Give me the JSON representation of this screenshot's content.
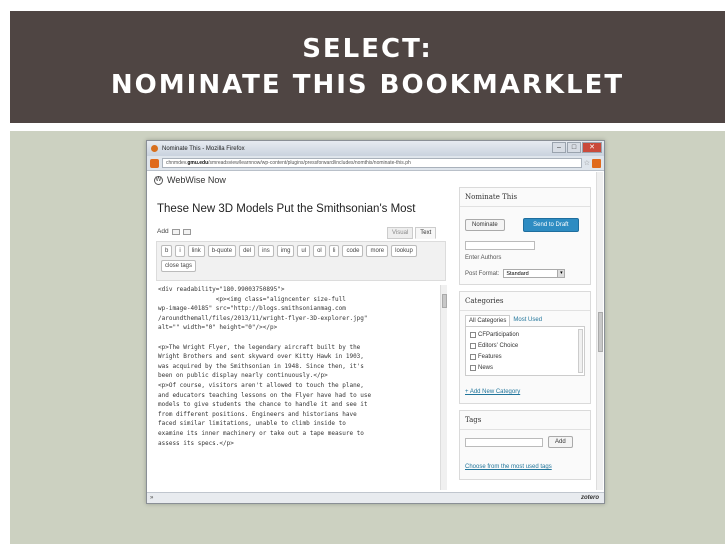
{
  "slide": {
    "title_line1": "SELECT:",
    "title_line2": "NOMINATE THIS BOOKMARKLET"
  },
  "browser": {
    "window_title": "Nominate This - Mozilla Firefox",
    "url_prefix": "chnmdev.",
    "url_domain": "gmu.edu",
    "url_rest": "/smreadsview/learnnow/wp-content/plugins/pressforward/includes/nomthis/nominate-this.ph",
    "min": "–",
    "max": "□",
    "close": "✕"
  },
  "editor": {
    "site_name": "WebWise Now",
    "post_title": "These New 3D Models Put the Smithsonian's Most",
    "add_label": "Add",
    "tab_visual": "Visual",
    "tab_text": "Text",
    "quicktags": [
      "b",
      "i",
      "link",
      "b-quote",
      "del",
      "ins",
      "img",
      "ul",
      "ol",
      "li",
      "code",
      "more",
      "lookup",
      "close tags"
    ],
    "code_lines": [
      "<div readability=\"180.99003750895\">",
      "                <p><img class=\"aligncenter size-full",
      "wp-image-40185\" src=\"http://blogs.smithsonianmag.com",
      "/aroundthemall/files/2013/11/wright-flyer-3D-explorer.jpg\"",
      "alt=\"\" width=\"0\" height=\"0\"/></p>",
      "",
      "<p>The Wright Flyer, the legendary aircraft built by the",
      "Wright Brothers and sent skyward over Kitty Hawk in 1903,",
      "was acquired by the Smithsonian in 1948. Since then, it's",
      "been on public display nearly continuously.</p>",
      "<p>Of course, visitors aren't allowed to touch the plane,",
      "and educators teaching lessons on the Flyer have had to use",
      "models to give students the chance to handle it and see it",
      "from different positions. Engineers and historians have",
      "faced similar limitations, unable to climb inside to",
      "examine its inner machinery or take out a tape measure to",
      "assess its specs.</p>"
    ]
  },
  "sidebar": {
    "nominate_box_title": "Nominate This",
    "nominate_button": "Nominate",
    "send_to_draft_button": "Send to Draft",
    "enter_authors_label": "Enter Authors",
    "post_format_label": "Post Format:",
    "post_format_value": "Standard",
    "categories_title": "Categories",
    "all_categories_tab": "All Categories",
    "most_used_tab": "Most Used",
    "categories": [
      "CFParticipation",
      "Editors' Choice",
      "Features",
      "News"
    ],
    "add_category_link": "+ Add New Category",
    "tags_title": "Tags",
    "tags_add_button": "Add",
    "tags_most_used_link": "Choose from the most used tags"
  },
  "status_bar": {
    "left": "»",
    "zotero": "zotero"
  }
}
